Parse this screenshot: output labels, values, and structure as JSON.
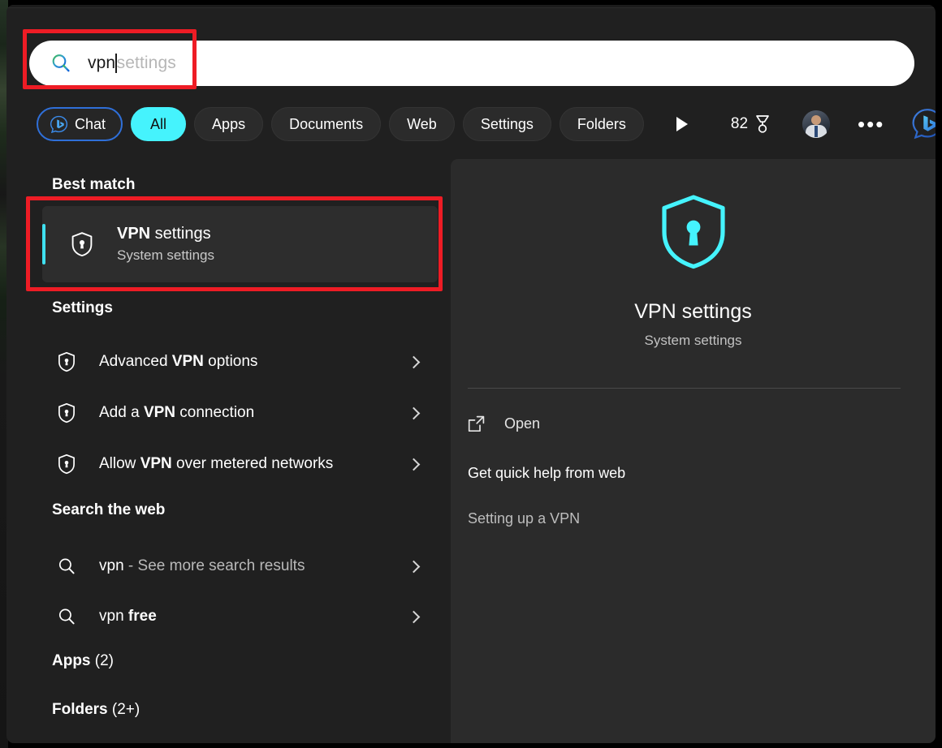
{
  "search": {
    "typed_value": "vpn",
    "autocomplete_suffix": "settings",
    "icon": "search-icon"
  },
  "filters": {
    "chat_label": "Chat",
    "chat_icon": "bing-chat-icon",
    "chips": [
      {
        "label": "All",
        "active": true
      },
      {
        "label": "Apps",
        "active": false
      },
      {
        "label": "Documents",
        "active": false
      },
      {
        "label": "Web",
        "active": false
      },
      {
        "label": "Settings",
        "active": false
      },
      {
        "label": "Folders",
        "active": false
      }
    ],
    "overflow_icon": "play-arrow-icon",
    "rewards_points": "82",
    "rewards_icon": "rewards-medal-icon",
    "avatar_icon": "user-avatar",
    "more_options": "•••",
    "bing_icon": "bing-logo-icon"
  },
  "results": {
    "best_match": {
      "heading": "Best match",
      "title_bold": "VPN",
      "title_rest": " settings",
      "subtitle": "System settings",
      "icon": "vpn-shield-icon"
    },
    "settings": {
      "heading": "Settings",
      "items": [
        {
          "pre": "Advanced ",
          "bold": "VPN",
          "post": " options",
          "icon": "vpn-shield-icon"
        },
        {
          "pre": "Add a ",
          "bold": "VPN",
          "post": " connection",
          "icon": "vpn-shield-icon"
        },
        {
          "pre": "Allow ",
          "bold": "VPN",
          "post": " over metered networks",
          "icon": "vpn-shield-icon"
        }
      ]
    },
    "web": {
      "heading": "Search the web",
      "items": [
        {
          "pre": "vpn",
          "bold": "",
          "post": " - See more search results",
          "dim_post": true,
          "icon": "search-icon"
        },
        {
          "pre": "vpn ",
          "bold": "free",
          "post": "",
          "dim_post": false,
          "icon": "search-icon"
        }
      ]
    },
    "apps": {
      "label": "Apps",
      "count": " (2)"
    },
    "folders": {
      "label": "Folders",
      "count": " (2+)"
    }
  },
  "preview": {
    "icon": "vpn-shield-icon",
    "title": "VPN settings",
    "subtitle": "System settings",
    "open_label": "Open",
    "open_icon": "external-link-icon",
    "help_heading": "Get quick help from web",
    "help_link": "Setting up a VPN"
  },
  "colors": {
    "accent_cyan": "#45f3fd",
    "annotation_red": "#ee1c25",
    "chat_border_blue": "#2f6fd8",
    "window_bg": "#202020",
    "preview_bg": "#2b2b2b"
  }
}
